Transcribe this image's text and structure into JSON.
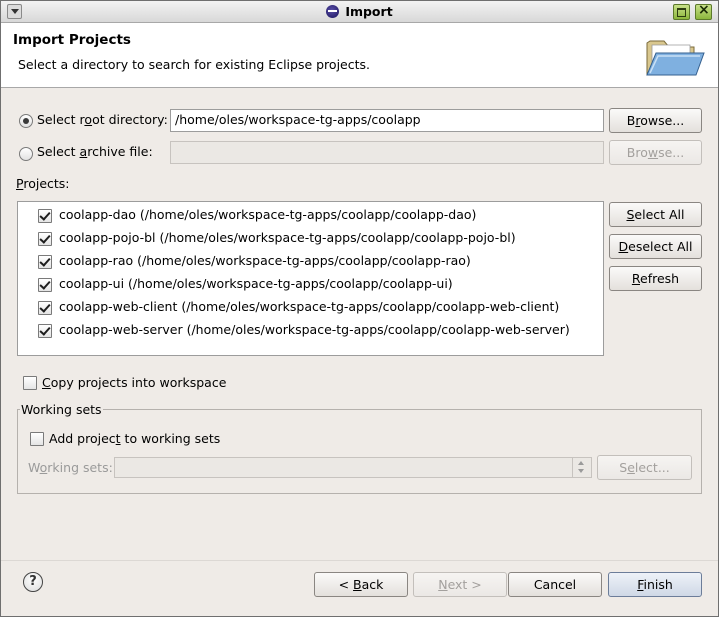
{
  "window": {
    "title": "Import"
  },
  "banner": {
    "title": "Import Projects",
    "description": "Select a directory to search for existing Eclipse projects.",
    "icon": "folder-open-icon"
  },
  "root_directory": {
    "label_pre": "Select r",
    "label_u": "o",
    "label_post": "ot directory:",
    "selected": true,
    "value": "/home/oles/workspace-tg-apps/coolapp",
    "browse_pre": "B",
    "browse_u": "r",
    "browse_post": "owse..."
  },
  "archive_file": {
    "label_pre": "Select ",
    "label_u": "a",
    "label_post": "rchive file:",
    "selected": false,
    "value": "",
    "browse_pre": "Bro",
    "browse_u": "w",
    "browse_post": "se..."
  },
  "projects": {
    "label_u": "P",
    "label_post": "rojects:",
    "items": [
      {
        "label": "coolapp-dao (/home/oles/workspace-tg-apps/coolapp/coolapp-dao)",
        "checked": true
      },
      {
        "label": "coolapp-pojo-bl (/home/oles/workspace-tg-apps/coolapp/coolapp-pojo-bl)",
        "checked": true
      },
      {
        "label": "coolapp-rao (/home/oles/workspace-tg-apps/coolapp/coolapp-rao)",
        "checked": true
      },
      {
        "label": "coolapp-ui (/home/oles/workspace-tg-apps/coolapp/coolapp-ui)",
        "checked": true
      },
      {
        "label": "coolapp-web-client (/home/oles/workspace-tg-apps/coolapp/coolapp-web-client)",
        "checked": true
      },
      {
        "label": "coolapp-web-server (/home/oles/workspace-tg-apps/coolapp/coolapp-web-server)",
        "checked": true
      }
    ],
    "select_all_u": "S",
    "select_all_post": "elect All",
    "deselect_all_u": "D",
    "deselect_all_post": "eselect All",
    "refresh_u": "R",
    "refresh_post": "efresh"
  },
  "copy_projects": {
    "label_u": "C",
    "label_post": "opy projects into workspace",
    "checked": false
  },
  "working_sets": {
    "group_title": "Working sets",
    "add_pre": "Add projec",
    "add_u": "t",
    "add_post": " to working sets",
    "add_checked": false,
    "field_pre": "W",
    "field_u": "o",
    "field_post": "rking sets:",
    "value": "",
    "select_pre": "S",
    "select_u": "e",
    "select_post": "lect..."
  },
  "footer": {
    "help_glyph": "?",
    "back_pre": "< ",
    "back_u": "B",
    "back_post": "ack",
    "next_pre": "",
    "next_u": "N",
    "next_post": "ext >",
    "cancel": "Cancel",
    "finish_u": "F",
    "finish_post": "inish"
  },
  "colors": {
    "background": "#efebe7",
    "banner": "#ffffff",
    "default_button": "#cfd8e6"
  }
}
